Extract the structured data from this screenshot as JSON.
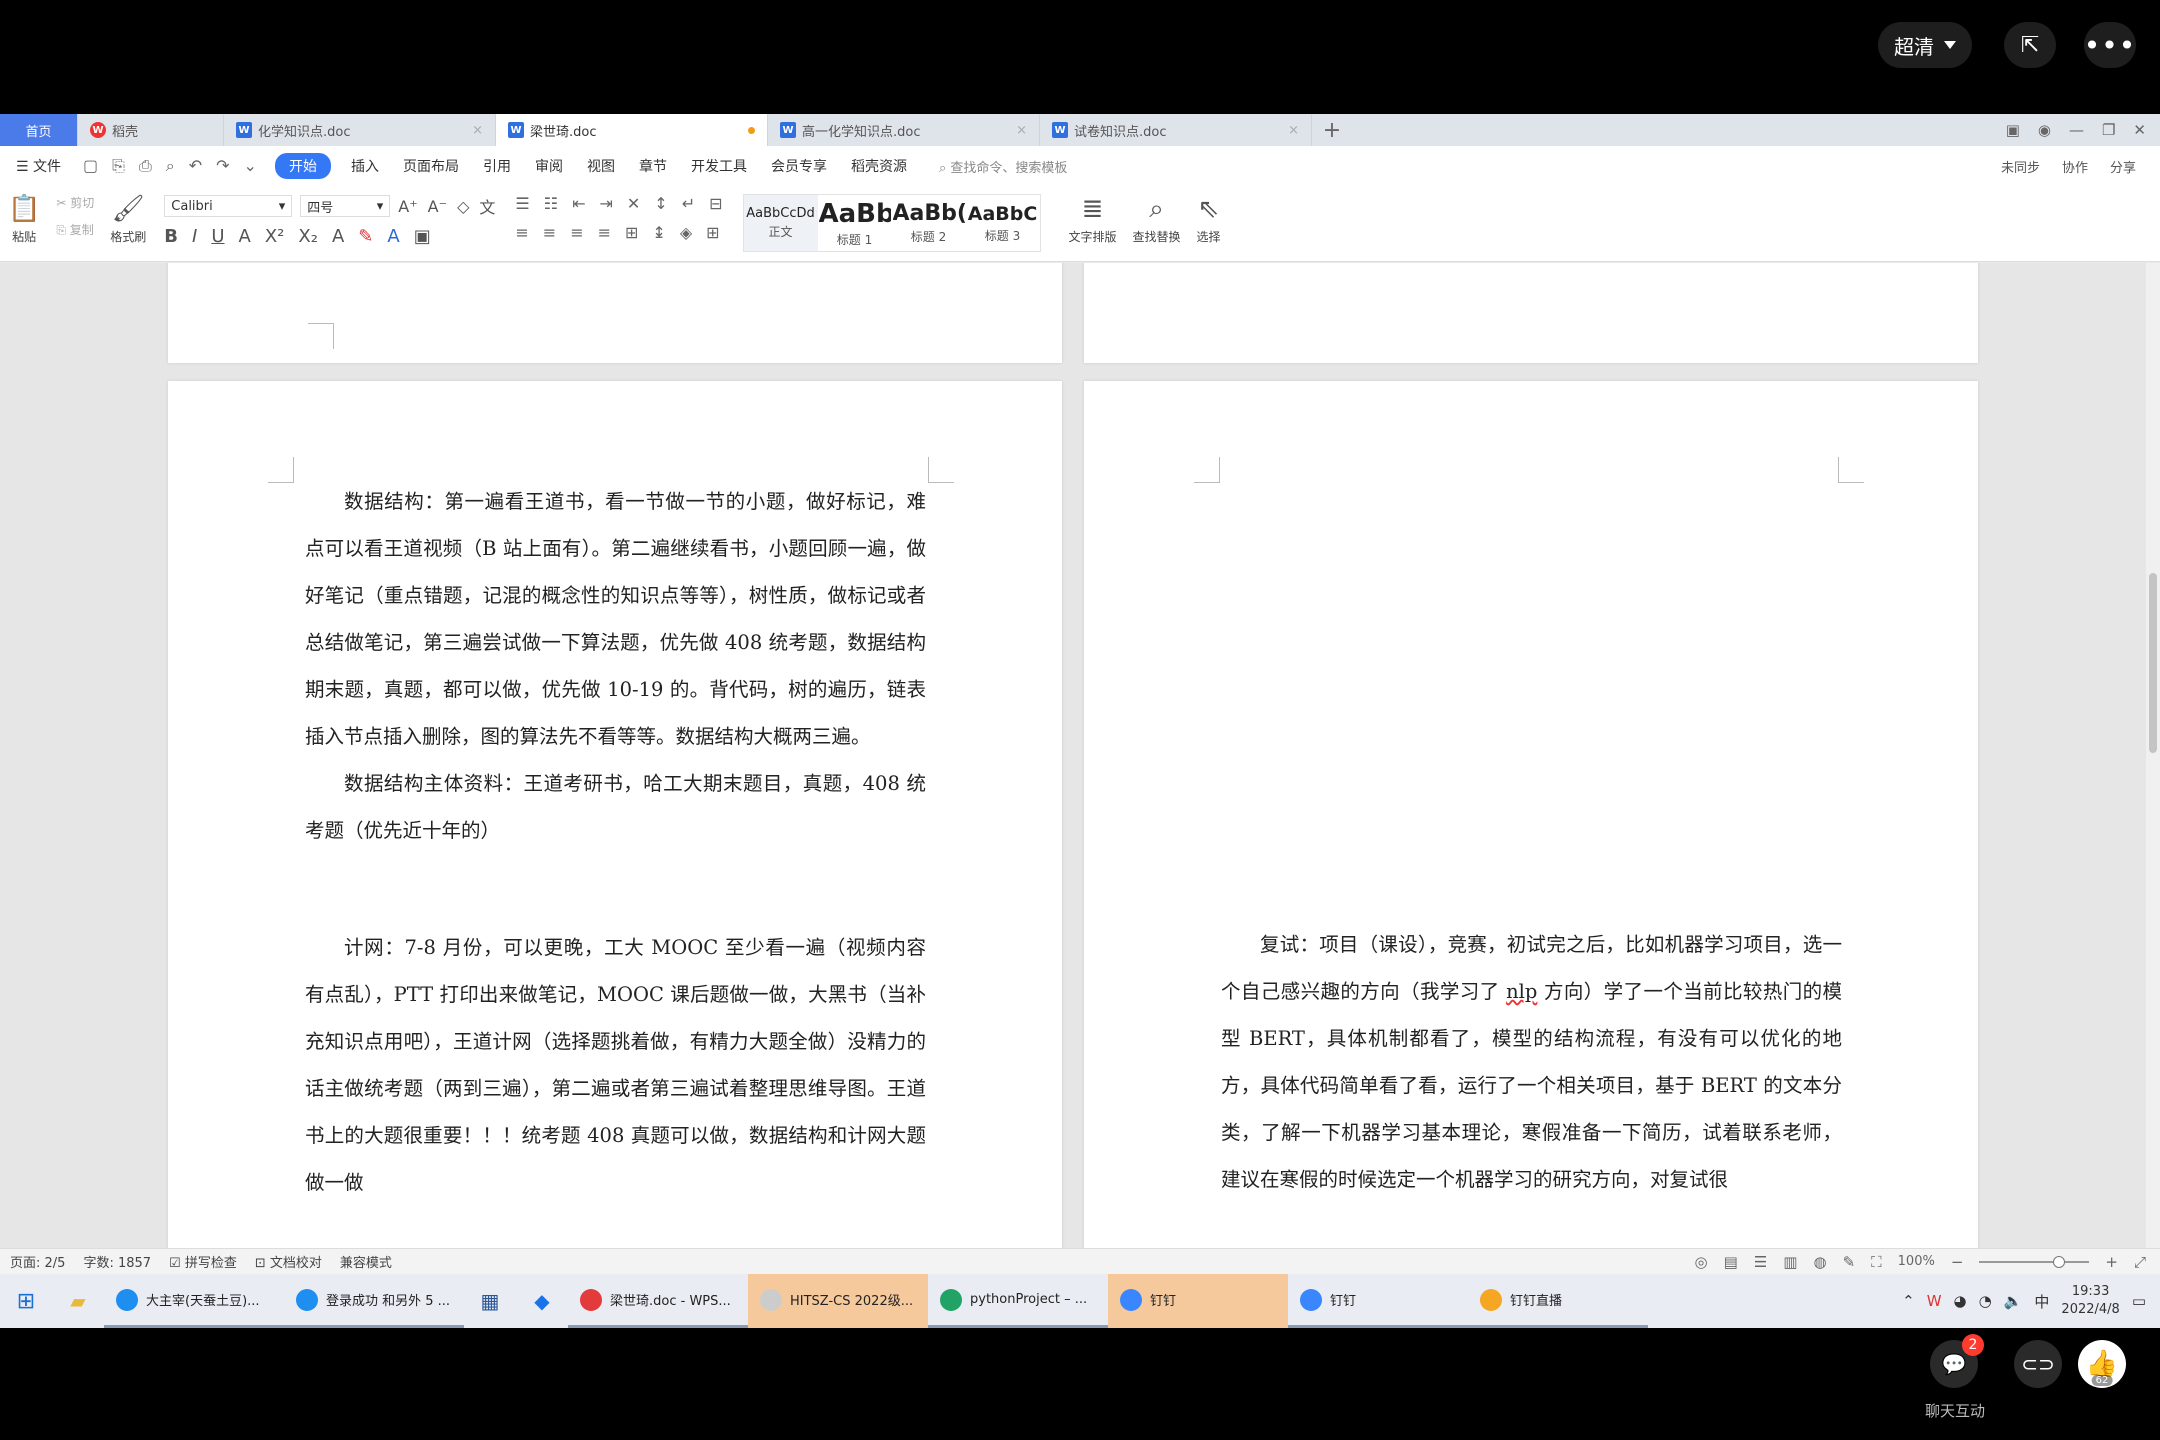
{
  "player": {
    "quality_label": "超清",
    "chat_label": "聊天互动",
    "chat_badge": "2",
    "avatar_count": "62"
  },
  "tabs": [
    {
      "label": "首页"
    },
    {
      "label": "稻壳"
    },
    {
      "label": "化学知识点.doc"
    },
    {
      "label": "梁世琦.doc"
    },
    {
      "label": "高一化学知识点.doc"
    },
    {
      "label": "试卷知识点.doc"
    }
  ],
  "menu": {
    "file": "文件",
    "items": [
      "开始",
      "插入",
      "页面布局",
      "引用",
      "审阅",
      "视图",
      "章节",
      "开发工具",
      "会员专享",
      "稻壳资源"
    ],
    "search": "查找命令、搜索模板",
    "right": [
      "未同步",
      "协作",
      "分享"
    ]
  },
  "ribbon": {
    "paste": "粘贴",
    "cut": "剪切",
    "copy": "复制",
    "format_painter": "格式刷",
    "font_name": "Calibri",
    "font_size": "四号",
    "styles": [
      {
        "sample": "AaBbCcDd",
        "label": "正文"
      },
      {
        "sample": "AaBb",
        "label": "标题 1"
      },
      {
        "sample": "AaBb(",
        "label": "标题 2"
      },
      {
        "sample": "AaBbC",
        "label": "标题 3"
      }
    ],
    "text_layout": "文字排版",
    "find_replace": "查找替换",
    "select": "选择"
  },
  "document": {
    "left_page": {
      "p1": "数据结构：第一遍看王道书，看一节做一节的小题，做好标记，难点可以看王道视频（B 站上面有）。第二遍继续看书，小题回顾一遍，做好笔记（重点错题，记混的概念性的知识点等等），树性质，做标记或者总结做笔记，第三遍尝试做一下算法题，优先做 408 统考题，数据结构期末题，真题，都可以做，优先做 10-19 的。背代码，树的遍历，链表插入节点插入删除，图的算法先不看等等。数据结构大概两三遍。",
      "p2": "数据结构主体资料：王道考研书，哈工大期末题目，真题，408 统考题（优先近十年的）",
      "p3": "计网：7-8 月份，可以更晚，工大 MOOC 至少看一遍（视频内容有点乱），PTT 打印出来做笔记，MOOC 课后题做一做，大黑书（当补充知识点用吧），王道计网（选择题挑着做，有精力大题全做）没精力的话主做统考题（两到三遍），第二遍或者第三遍试着整理思维导图。王道书上的大题很重要！！！统考题 408 真题可以做，数据结构和计网大题做一做"
    },
    "right_page": {
      "p1_before": "复试：项目（课设），竞赛，初试完之后，比如机器学习项目，选一个自己感兴趣的方向（我学习了 ",
      "p1_underlined": "nlp",
      "p1_after": " 方向）学了一个当前比较热门的模型 BERT，具体机制都看了，模型的结构流程，有没有可以优化的地方，具体代码简单看了看，运行了一个相关项目，基于 BERT 的文本分类，了解一下机器学习基本理论，寒假准备一下简历，试着联系老师，建议在寒假的时候选定一个机器学习的研究方向，对复试很"
    }
  },
  "status": {
    "page": "页面: 2/5",
    "words": "字数: 1857",
    "spell": "拼写检查",
    "proof": "文档校对",
    "compat": "兼容模式",
    "zoom": "100%"
  },
  "taskbar": {
    "apps": [
      {
        "label": "大主宰(天蚕土豆)...",
        "color": "#1f8ef1"
      },
      {
        "label": "登录成功 和另外 5 ...",
        "color": "#1f8ef1"
      },
      {
        "label": "梁世琦.doc - WPS...",
        "color": "#e33b3b"
      },
      {
        "label": "HITSZ-CS 2022级...",
        "color": "#cccccc"
      },
      {
        "label": "pythonProject – ...",
        "color": "#21a366"
      },
      {
        "label": "钉钉",
        "color": "#3a86ff"
      },
      {
        "label": "钉钉",
        "color": "#3a86ff"
      },
      {
        "label": "钉钉直播",
        "color": "#f5a623"
      }
    ],
    "ime": "中",
    "time": "19:33",
    "date": "2022/4/8"
  }
}
